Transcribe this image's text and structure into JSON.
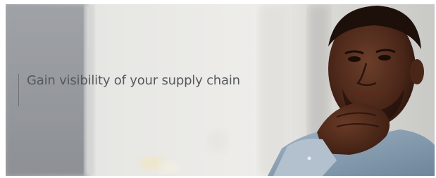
{
  "hero": {
    "headline": "Gain visibility of your supply chain"
  }
}
